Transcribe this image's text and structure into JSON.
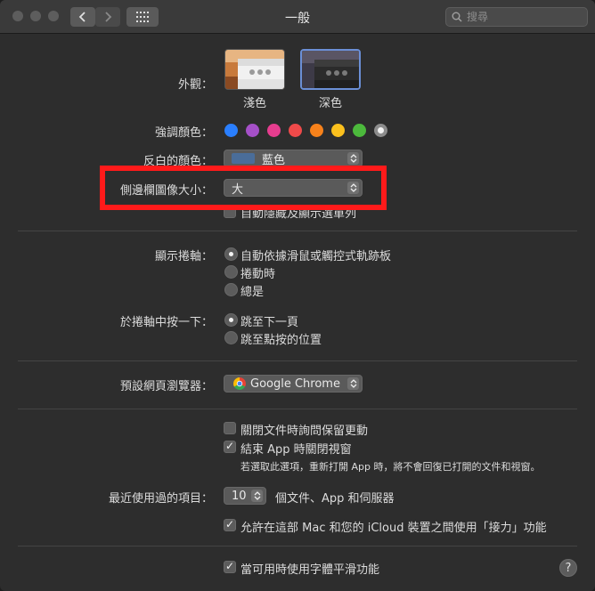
{
  "window": {
    "title": "一般"
  },
  "search": {
    "placeholder": "搜尋"
  },
  "appearance": {
    "label": "外觀：",
    "options": [
      {
        "label": "淺色"
      },
      {
        "label": "深色"
      }
    ],
    "selected": "深色"
  },
  "accent": {
    "label": "強調顏色：",
    "colors": [
      "#2a7fff",
      "#a550c8",
      "#e63d8f",
      "#ef4a4a",
      "#f7821b",
      "#fbc01d",
      "#4cb93c",
      "#8c8c8c"
    ],
    "selected_index": 7
  },
  "highlight": {
    "label": "反白的顏色：",
    "value": "藍色",
    "swatch": "#4a6d99"
  },
  "sidebar_icon": {
    "label": "側邊欄圖像大小：",
    "value": "大"
  },
  "auto_hide_menu": {
    "label": "自動隱藏及顯示選單列",
    "checked": false
  },
  "show_scrollbars": {
    "label": "顯示捲軸：",
    "options": [
      "自動依據滑鼠或觸控式軌跡板",
      "捲動時",
      "總是"
    ],
    "selected": 0
  },
  "click_scrollbar": {
    "label": "於捲軸中按一下：",
    "options": [
      "跳至下一頁",
      "跳至點按的位置"
    ],
    "selected": 0
  },
  "browser": {
    "label": "預設網頁瀏覽器：",
    "value": "Google Chrome"
  },
  "ask_keep_changes": {
    "label": "關閉文件時詢問保留更動",
    "checked": false
  },
  "close_windows": {
    "label": "結束 App 時關閉視窗",
    "checked": true
  },
  "close_windows_note": "若選取此選項，重新打開 App 時，將不會回復已打開的文件和視窗。",
  "recent_items": {
    "label": "最近使用過的項目：",
    "value": "10",
    "suffix": "個文件、App 和伺服器"
  },
  "handoff": {
    "label": "允許在這部 Mac 和您的 iCloud 裝置之間使用「接力」功能",
    "checked": true
  },
  "font_smoothing": {
    "label": "當可用時使用字體平滑功能",
    "checked": true
  },
  "help": {
    "label": "?"
  },
  "annotation": {
    "color": "#ff1a1a"
  }
}
